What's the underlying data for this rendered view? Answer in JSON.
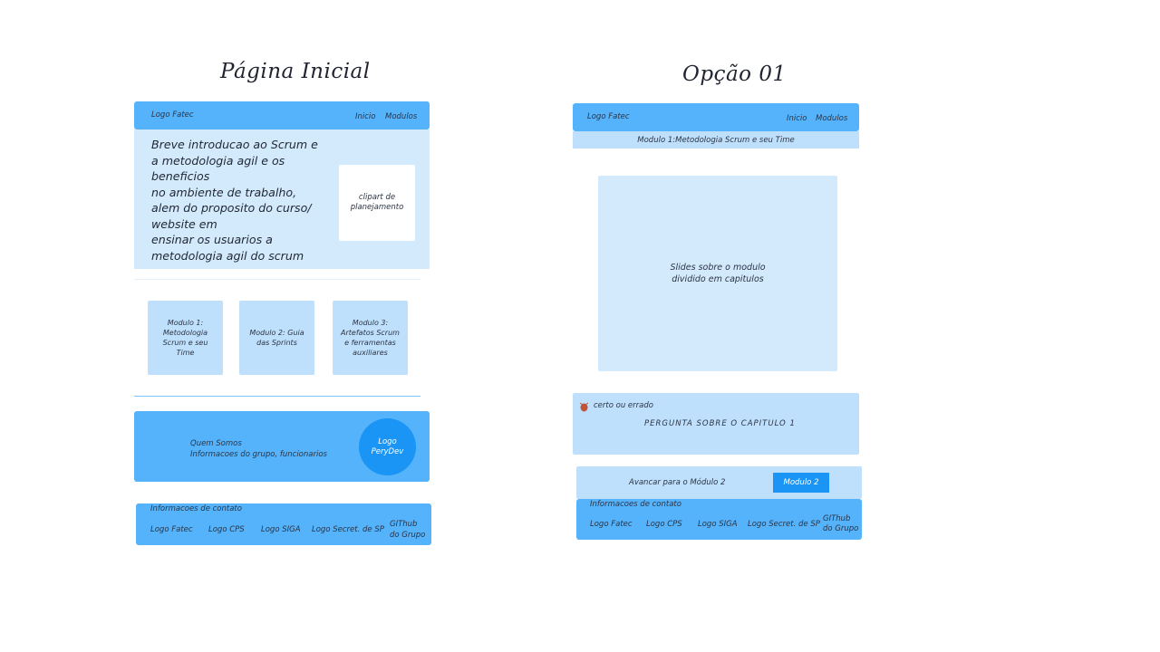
{
  "left": {
    "title": "Página Inicial",
    "header": {
      "logo": "Logo Fatec",
      "nav_inicio": "Inicio",
      "nav_modulos": "Modulos"
    },
    "hero": {
      "lines": [
        "Breve introducao ao Scrum e",
        "a metodologia agil e os",
        "beneficios",
        "no ambiente de trabalho,",
        "alem do proposito do curso/",
        "website em",
        "ensinar os usuarios a",
        "metodologia agil do scrum"
      ],
      "image_label": "clipart de\nplanejamento"
    },
    "modules": [
      "Modulo 1:\nMetodologia\nScrum e seu\nTime",
      "Modulo 2: Guia\ndas Sprints",
      "Modulo 3:\nArtefatos Scrum\ne ferramentas\nauxiliares"
    ],
    "about": {
      "title": "Quem Somos",
      "subtitle": "Informacoes do grupo, funcionarios",
      "logo": "Logo\nPeryDev"
    },
    "footer": {
      "heading": "Informacoes de contato",
      "items": [
        "Logo Fatec",
        "Logo CPS",
        "Logo SIGA",
        "Logo Secret. de SP",
        "GIThub\ndo Grupo"
      ]
    }
  },
  "right": {
    "title": "Opção 01",
    "header": {
      "logo": "Logo Fatec",
      "nav_inicio": "Inicio",
      "nav_modulos": "Modulos"
    },
    "subheader": "Modulo 1:Metodologia Scrum e seu Time",
    "slides_label": "Slides sobre o modulo\ndividido em capitulos",
    "quiz": {
      "tag": "certo ou errado",
      "question": "PERGUNTA SOBRE O CAPITULO 1"
    },
    "advance": {
      "label": "Avancar para o Módulo 2",
      "button": "Modulo 2"
    },
    "footer": {
      "heading": "Informacoes de contato",
      "items": [
        "Logo Fatec",
        "Logo CPS",
        "Logo SIGA",
        "Logo Secret. de SP",
        "GIThub\ndo Grupo"
      ]
    }
  },
  "colors": {
    "primary": "#55b3fb",
    "light": "#d3eafd",
    "mid": "#bfe0fc",
    "button": "#1a94f5",
    "bug": "#c0533b"
  }
}
